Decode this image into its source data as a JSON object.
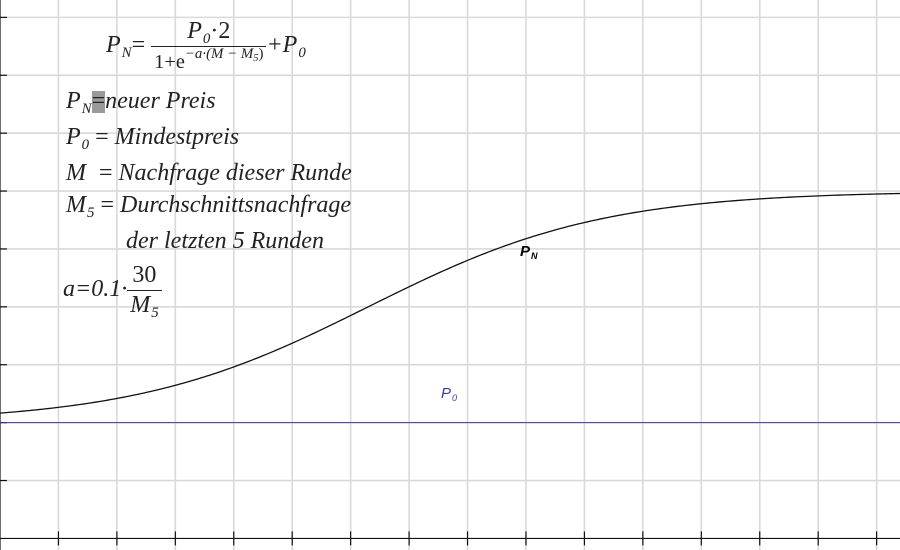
{
  "formula": {
    "lhs": "P",
    "lhs_sub": "N",
    "eq": "=",
    "num_p": "P",
    "num_p_sub": "0",
    "num_rest": "·2",
    "den_one": "1+e",
    "exp_text": "−a·(M − M",
    "exp_sub": "5",
    "exp_close": ")",
    "plus": "+P",
    "plus_sub": "0"
  },
  "legend_lines": [
    {
      "sym": "P",
      "sub": "N",
      "eq": "=",
      "text": "neuer Preis"
    },
    {
      "sym": "P",
      "sub": "0",
      "eq": " = ",
      "text": "Mindestpreis"
    },
    {
      "sym": "M",
      "sub": "",
      "eq": "  = ",
      "text": "Nachfrage dieser Runde"
    },
    {
      "sym": "M",
      "sub": "5",
      "eq": " = ",
      "text": "Durchschnittsnachfrage"
    }
  ],
  "legend_continuation": "der letzten 5 Runden",
  "a_formula": {
    "lhs": "a=0.1·",
    "num": "30",
    "den": "M",
    "den_sub": "5"
  },
  "curve_labels": {
    "pn": {
      "main": "P",
      "sub": "N",
      "color": "#000000"
    },
    "p0": {
      "main": "P",
      "sub": "0",
      "color": "#3b3b9e"
    }
  },
  "colors": {
    "grid": "#d9d9d9",
    "axis": "#111111",
    "pn_curve": "#111111",
    "p0_line": "#3b3b9e"
  },
  "chart_data": {
    "type": "line",
    "title": "",
    "xlabel": "",
    "ylabel": "",
    "grid": true,
    "xlim": [
      0,
      15.4
    ],
    "ylim": [
      -0.2,
      9.3
    ],
    "series": [
      {
        "kind": "logistic",
        "P0": 2,
        "a": 0.5,
        "center": 6.3
      },
      {
        "kind": "constant",
        "value": 2
      }
    ]
  }
}
